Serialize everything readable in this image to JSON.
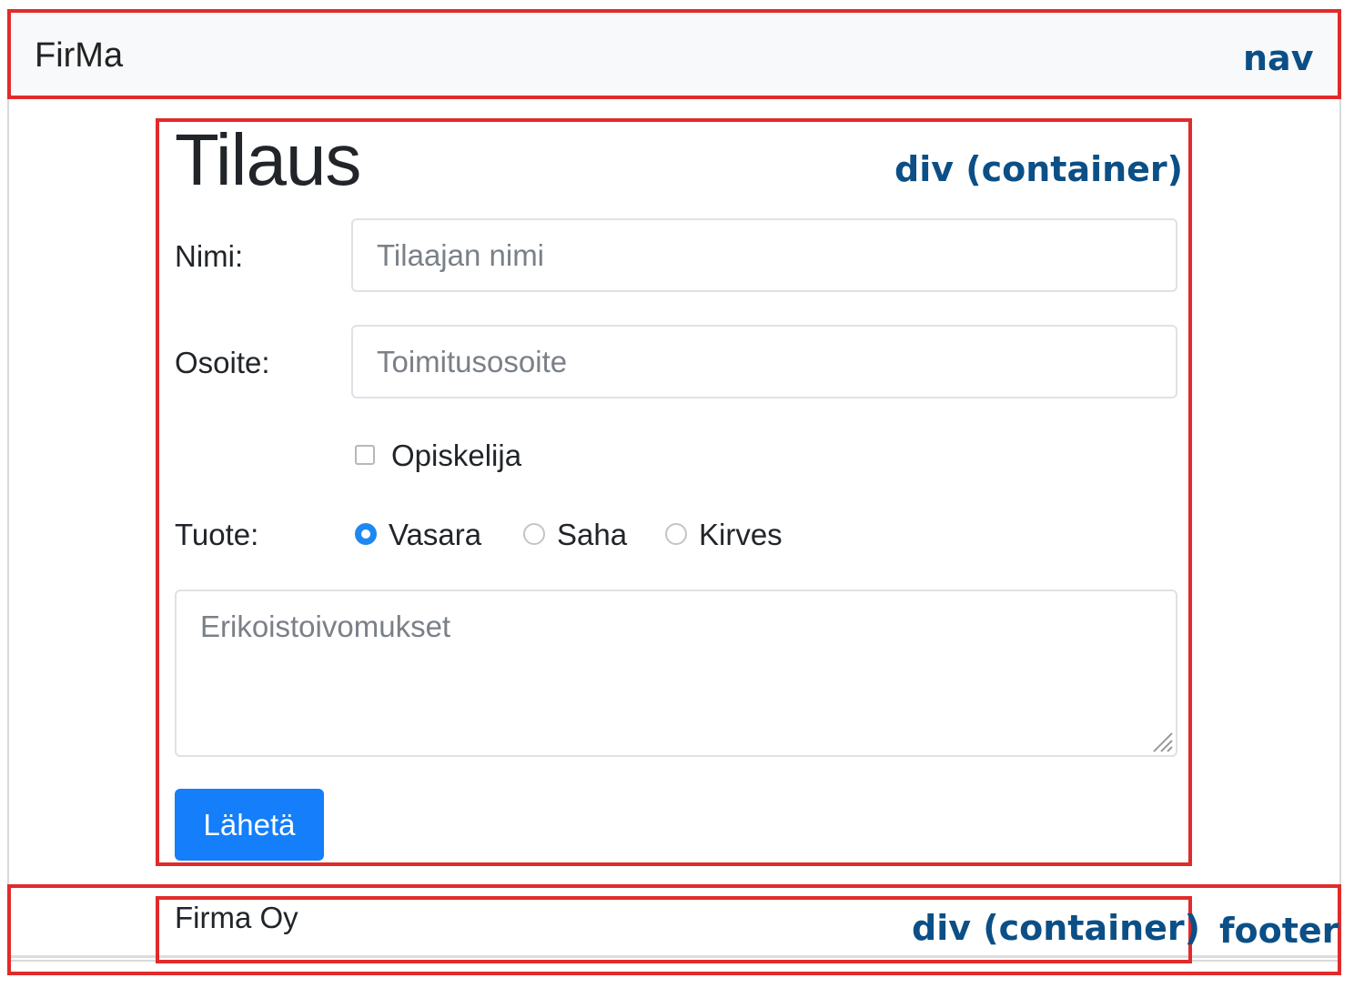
{
  "nav": {
    "brand": "FirMa"
  },
  "annotations": {
    "nav": "nav",
    "main_container": "div (container)",
    "footer_container": "div (container)",
    "footer": "footer"
  },
  "form": {
    "title": "Tilaus",
    "name_label": "Nimi:",
    "name_placeholder": "Tilaajan nimi",
    "name_value": "",
    "address_label": "Osoite:",
    "address_placeholder": "Toimitusosoite",
    "address_value": "",
    "student_label": "Opiskelija",
    "student_checked": false,
    "product_label": "Tuote:",
    "products": [
      {
        "label": "Vasara",
        "checked": true
      },
      {
        "label": "Saha",
        "checked": false
      },
      {
        "label": "Kirves",
        "checked": false
      }
    ],
    "notes_placeholder": "Erikoistoivomukset",
    "notes_value": "",
    "submit_label": "Lähetä"
  },
  "footer": {
    "text": "Firma Oy"
  },
  "colors": {
    "annotation_border": "#e12b2b",
    "annotation_text": "#0b4f86",
    "primary_button": "#147efb",
    "radio_checked": "#1e88f0",
    "nav_background": "#f8f9fa"
  }
}
